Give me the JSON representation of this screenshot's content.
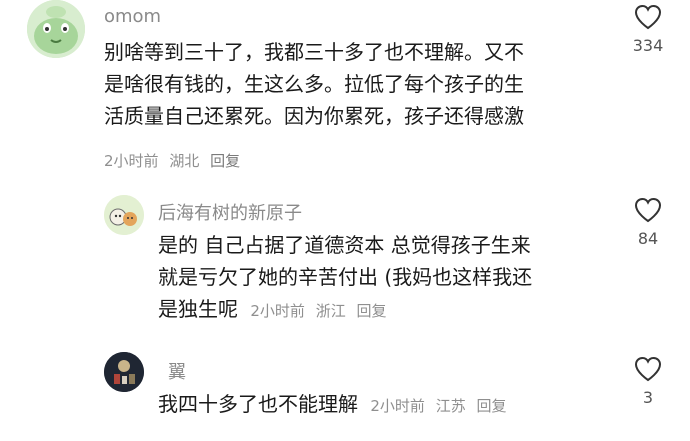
{
  "comments": [
    {
      "username": "omom",
      "lines": [
        "别啥等到三十了，我都三十多了也不理解。又不",
        "是啥很有钱的，生这么多。拉低了每个孩子的生",
        "活质量自己还累死。因为你累死，孩子还得感激"
      ],
      "time": "2小时前",
      "location": "湖北",
      "reply_label": "回复",
      "likes": "334",
      "avatar_icon": "green-cartoon-avatar"
    },
    {
      "username": "后海有树的新原子",
      "lines": [
        "是的 自己占据了道德资本 总觉得孩子生来",
        "就是亏欠了她的辛苦付出 (我妈也这样我还",
        "是独生呢"
      ],
      "time": "2小时前",
      "location": "浙江",
      "reply_label": "回复",
      "likes": "84",
      "avatar_icon": "cartoon-animals-avatar"
    },
    {
      "username": "翼",
      "lines": [
        "我四十多了也不能理解"
      ],
      "time": "2小时前",
      "location": "江苏",
      "reply_label": "回复",
      "likes": "3",
      "avatar_icon": "dark-photo-avatar"
    }
  ],
  "colors": {
    "text": "#1a1a1a",
    "meta": "#8f8f8f",
    "username": "#8a8a8a"
  },
  "icons": {
    "like": "heart-outline-icon"
  }
}
